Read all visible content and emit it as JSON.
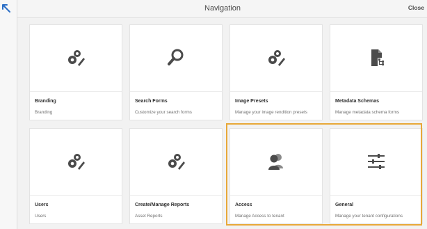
{
  "header": {
    "title": "Navigation",
    "close_label": "Close"
  },
  "cards": [
    {
      "title": "Branding",
      "desc": "Branding",
      "icon": "gears-pencil-icon"
    },
    {
      "title": "Search Forms",
      "desc": "Customize your search forms",
      "icon": "magnifier-icon"
    },
    {
      "title": "Image Presets",
      "desc": "Manage your image rendition presets",
      "icon": "gears-pencil-icon"
    },
    {
      "title": "Metadata Schemas",
      "desc": "Manage metadata schema forms",
      "icon": "document-tree-icon"
    },
    {
      "title": "Users",
      "desc": "Users",
      "icon": "gears-pencil-icon"
    },
    {
      "title": "Create/Manage Reports",
      "desc": "Asset Reports",
      "icon": "gears-pencil-icon"
    },
    {
      "title": "Access",
      "desc": "Manage Access to tenant",
      "icon": "users-icon"
    },
    {
      "title": "General",
      "desc": "Manage your tenant configurations",
      "icon": "sliders-icon"
    }
  ],
  "selected_group": [
    "Access",
    "General"
  ],
  "colors": {
    "selection": "#e8a838",
    "icon": "#4b4b4b"
  }
}
